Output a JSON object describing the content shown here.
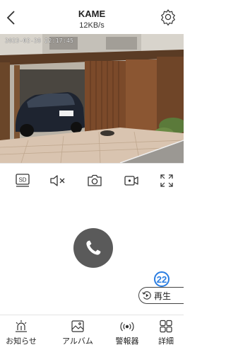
{
  "header": {
    "title": "KAME",
    "speed": "12KB/s"
  },
  "video": {
    "timestamp": "2023-02-28 22:17:45"
  },
  "toolbar": {
    "quality_label": "SD"
  },
  "badge": {
    "number": "22"
  },
  "replay": {
    "label": "再生"
  },
  "tabs": [
    {
      "label": "お知らせ",
      "icon": "notification-icon"
    },
    {
      "label": "アルバム",
      "icon": "album-icon"
    },
    {
      "label": "警報器",
      "icon": "alarm-icon"
    },
    {
      "label": "詳細",
      "icon": "grid-icon"
    }
  ],
  "colors": {
    "accent": "#2a7de1",
    "call_button": "#5a5a5a"
  }
}
